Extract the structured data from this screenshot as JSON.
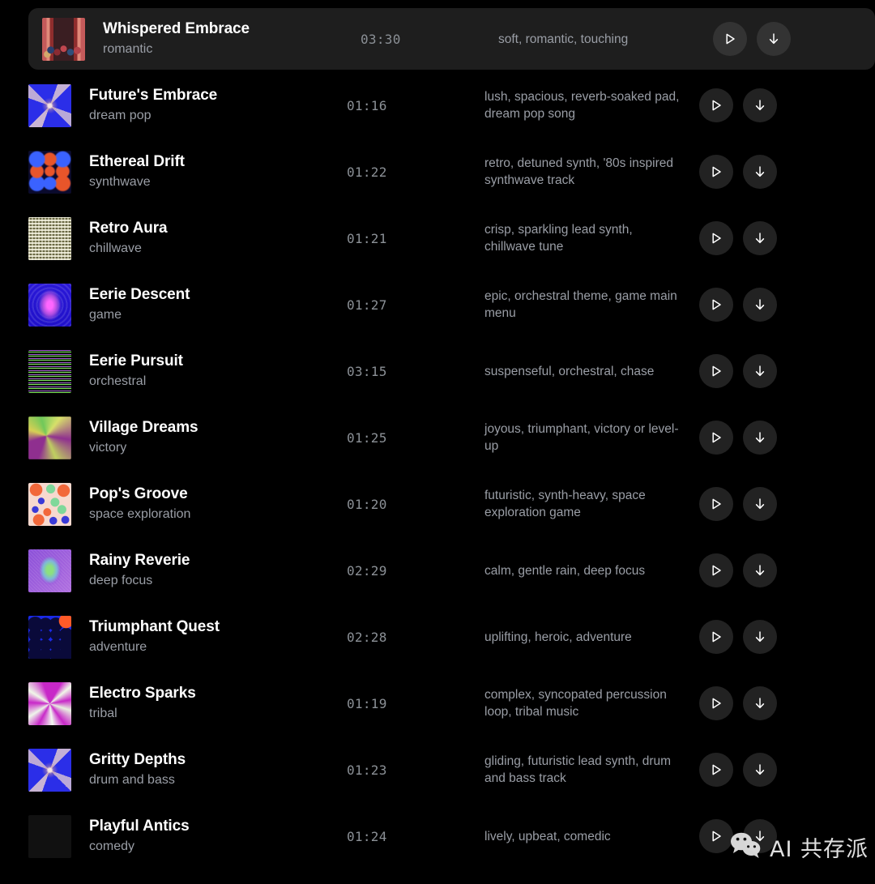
{
  "list": {
    "columns": [
      "thumbnail",
      "title",
      "genre",
      "duration",
      "description",
      "actions"
    ],
    "play_label": "Play",
    "download_label": "Download",
    "tracks": [
      {
        "title": "Whispered Embrace",
        "genre": "romantic",
        "duration": "03:30",
        "description": "soft, romantic, touching",
        "thumb": "p-crowd",
        "active": true
      },
      {
        "title": "Future's Embrace",
        "genre": "dream pop",
        "duration": "01:16",
        "description": "lush, spacious, reverb-soaked pad, dream pop song",
        "thumb": "p-xstar",
        "active": false
      },
      {
        "title": "Ethereal Drift",
        "genre": "synthwave",
        "duration": "01:22",
        "description": "retro, detuned synth, '80s inspired synthwave track",
        "thumb": "p-dots",
        "active": false
      },
      {
        "title": "Retro Aura",
        "genre": "chillwave",
        "duration": "01:21",
        "description": "crisp, sparkling lead synth, chillwave tune",
        "thumb": "p-plaid",
        "active": false
      },
      {
        "title": "Eerie Descent",
        "genre": "game",
        "duration": "01:27",
        "description": "epic, orchestral theme, game main menu",
        "thumb": "p-eerie",
        "active": false
      },
      {
        "title": "Eerie Pursuit",
        "genre": "orchestral",
        "duration": "03:15",
        "description": "suspenseful, orchestral, chase",
        "thumb": "p-stripes",
        "active": false
      },
      {
        "title": "Village Dreams",
        "genre": "victory",
        "duration": "01:25",
        "description": "joyous, triumphant, victory or level-up",
        "thumb": "p-swirl",
        "active": false
      },
      {
        "title": "Pop's Groove",
        "genre": "space exploration",
        "duration": "01:20",
        "description": "futuristic, synth-heavy, space exploration game",
        "thumb": "p-pop",
        "active": false
      },
      {
        "title": "Rainy Reverie",
        "genre": "deep focus",
        "duration": "02:29",
        "description": "calm, gentle rain, deep focus",
        "thumb": "p-rainy",
        "active": false
      },
      {
        "title": "Triumphant Quest",
        "genre": "adventure",
        "duration": "02:28",
        "description": "uplifting, heroic, adventure",
        "thumb": "p-quest",
        "active": false
      },
      {
        "title": "Electro Sparks",
        "genre": "tribal",
        "duration": "01:19",
        "description": "complex, syncopated percussion loop, tribal music",
        "thumb": "p-spark",
        "active": false
      },
      {
        "title": "Gritty Depths",
        "genre": "drum and bass",
        "duration": "01:23",
        "description": "gliding, futuristic lead synth, drum and bass track",
        "thumb": "p-xstar",
        "active": false
      },
      {
        "title": "Playful Antics",
        "genre": "comedy",
        "duration": "01:24",
        "description": "lively, upbeat, comedic",
        "thumb": "p-mosaic",
        "active": false
      }
    ]
  },
  "watermark": {
    "text": "AI 共存派",
    "icon": "wechat-icon"
  },
  "colors": {
    "background": "#000000",
    "active_row": "#1e1e1e",
    "title": "#ffffff",
    "secondary_text": "#9a9ea6",
    "button_bg": "#222222"
  }
}
